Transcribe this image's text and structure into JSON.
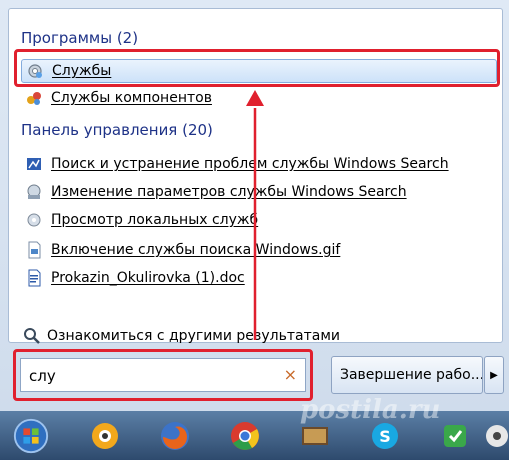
{
  "programs": {
    "title": "Программы (2)",
    "items": [
      {
        "label": "Службы",
        "icon": "services-gear-icon"
      },
      {
        "label": "Службы компонентов",
        "icon": "component-services-icon"
      }
    ]
  },
  "control_panel": {
    "title": "Панель управления (20)",
    "items": [
      {
        "label": "Поиск и устранение проблем службы Windows Search",
        "icon": "troubleshoot-icon"
      },
      {
        "label": "Изменение параметров службы Windows Search",
        "icon": "search-settings-icon"
      },
      {
        "label": "Просмотр локальных служб",
        "icon": "local-services-icon"
      },
      {
        "label": "Включение службы поиска Windows.gif",
        "icon": "gif-file-icon"
      },
      {
        "label": "Prokazin_Okulirovka (1).doc",
        "icon": "doc-file-icon"
      }
    ]
  },
  "more_results": "Ознакомиться с другими результатами",
  "search": {
    "value": "слу",
    "clear": "×"
  },
  "shutdown": {
    "label": "Завершение рабо...",
    "arrow": "▶"
  },
  "watermark": "postila.ru",
  "colors": {
    "accent": "#1e3287",
    "highlight": "#e0202e",
    "selection": "#cde2f9"
  },
  "taskbar": [
    "start-orb-icon",
    "xnview-icon",
    "firefox-icon",
    "chrome-icon",
    "film-icon",
    "skype-icon",
    "green-app-icon",
    "media-icon"
  ]
}
